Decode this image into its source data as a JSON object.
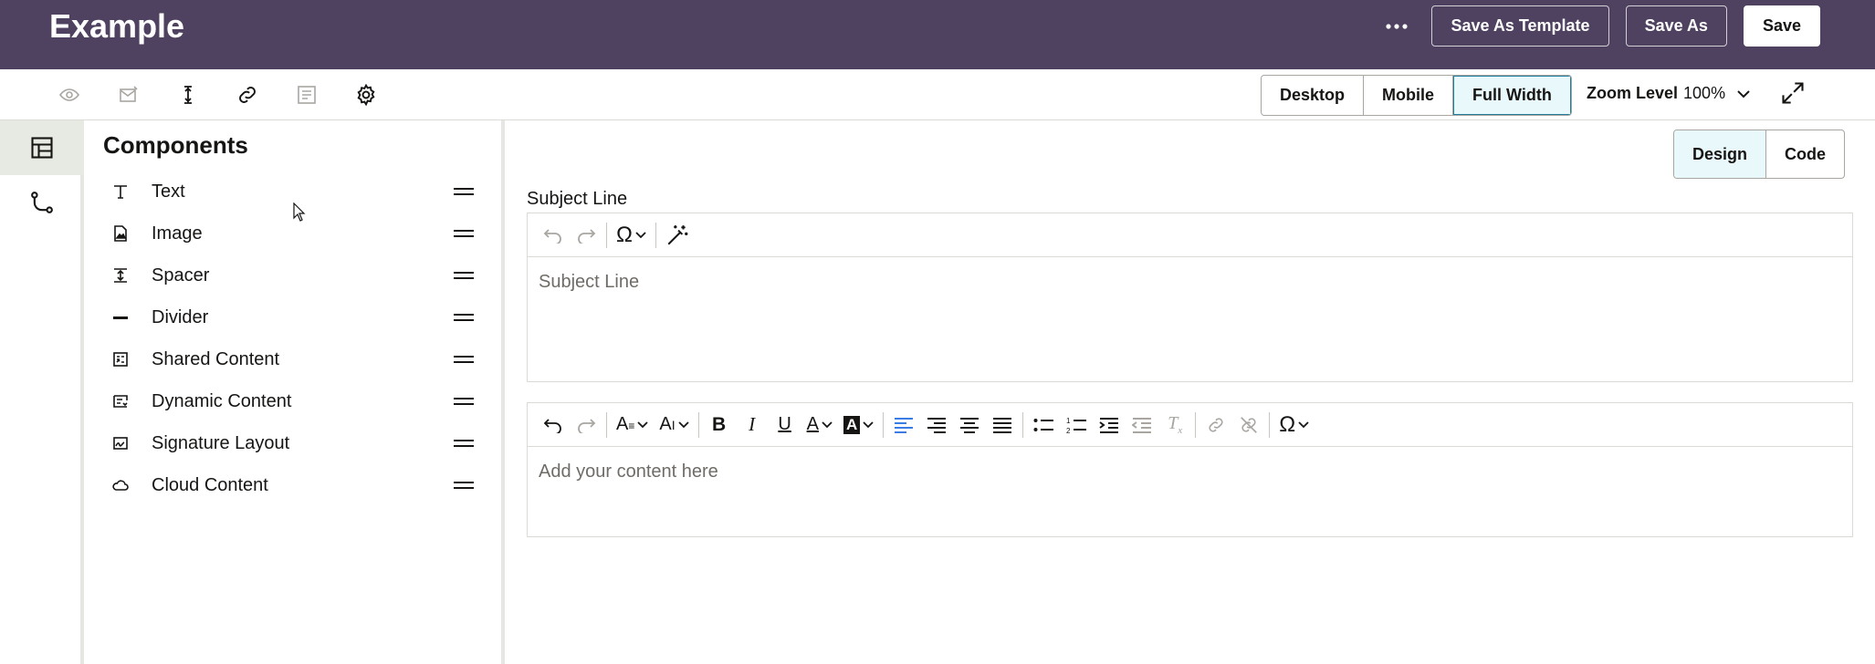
{
  "header": {
    "title": "Example",
    "actions": {
      "save_as_template": "Save As Template",
      "save_as": "Save As",
      "save": "Save"
    }
  },
  "toolbar": {
    "icons": [
      "eye-icon",
      "mail-icon",
      "text-cursor-icon",
      "link-icon",
      "list-icon",
      "gear-icon"
    ],
    "views": [
      "Desktop",
      "Mobile",
      "Full Width"
    ],
    "active_view": "Full Width",
    "zoom_label": "Zoom Level",
    "zoom_value": "100%"
  },
  "rail": {
    "items": [
      "layout-icon",
      "flow-icon"
    ]
  },
  "components": {
    "title": "Components",
    "items": [
      {
        "label": "Text",
        "icon": "text-icon"
      },
      {
        "label": "Image",
        "icon": "image-icon"
      },
      {
        "label": "Spacer",
        "icon": "spacer-icon"
      },
      {
        "label": "Divider",
        "icon": "divider-icon"
      },
      {
        "label": "Shared Content",
        "icon": "shared-content-icon"
      },
      {
        "label": "Dynamic Content",
        "icon": "dynamic-content-icon"
      },
      {
        "label": "Signature Layout",
        "icon": "signature-icon"
      },
      {
        "label": "Cloud Content",
        "icon": "cloud-icon"
      }
    ]
  },
  "main": {
    "modes": [
      "Design",
      "Code"
    ],
    "active_mode": "Design",
    "subject_label": "Subject Line",
    "subject_placeholder": "Subject Line",
    "content_placeholder": "Add your content here"
  },
  "colors": {
    "header_bg": "#4f4160",
    "accent": "#227e9e",
    "active_align": "#3b7be6"
  }
}
